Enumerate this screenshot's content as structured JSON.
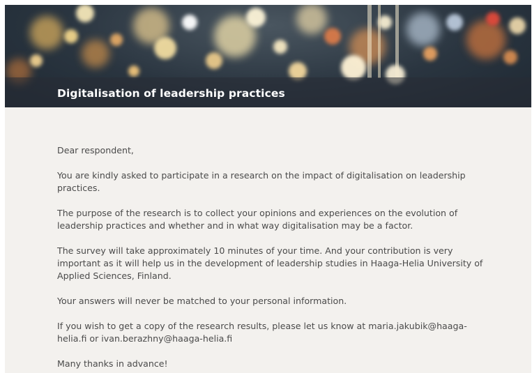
{
  "header": {
    "title": "Digitalisation of leadership practices"
  },
  "intro": {
    "greeting": "Dear respondent,",
    "paragraphs": [
      "You are kindly asked to participate in a research on the impact of digitalisation on leadership practices.",
      "The purpose of the research is to collect your opinions and experiences on the evolution of leadership practices and whether and in what way digitalisation may be a factor.",
      "The survey will take approximately 10 minutes of your time. And your contribution is very important as it will help us in the development of leadership studies in Haaga-Helia University of Applied Sciences, Finland.",
      "Your answers will never be matched to your personal information.",
      "If you wish to get a copy of the research results, please let us know at maria.jakubik@haaga-helia.fi or ivan.berazhny@haaga-helia.fi",
      "Many thanks in advance!"
    ]
  },
  "colors": {
    "page_background": "#f3f1ee",
    "title_text": "#ffffff",
    "body_text": "#4a4a4a"
  }
}
